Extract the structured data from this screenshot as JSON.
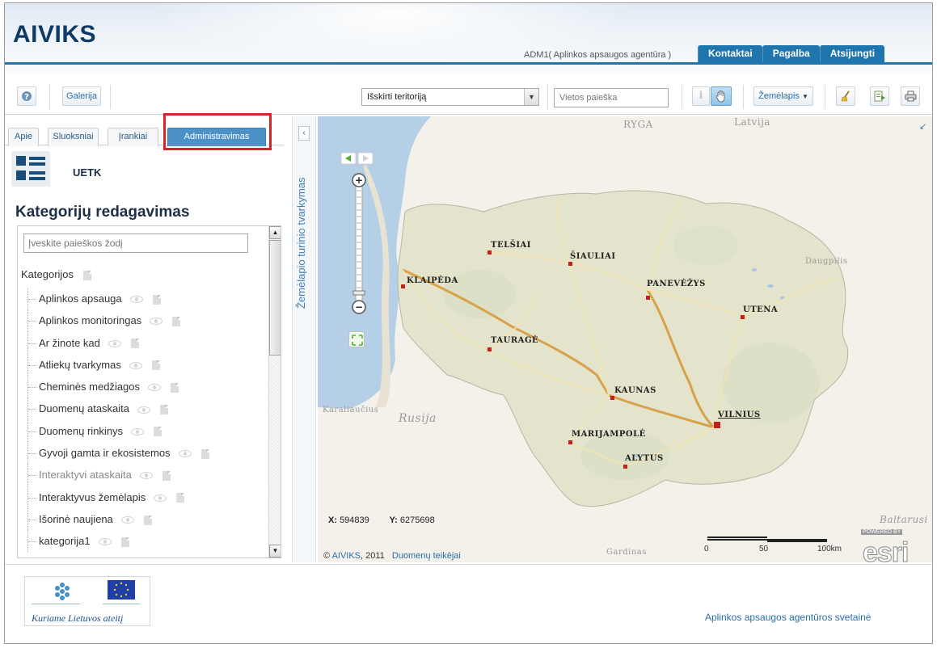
{
  "header": {
    "logo": "AIVIKS",
    "user": "ADM1( Aplinkos apsaugos agentūra )",
    "nav": [
      "Kontaktai",
      "Pagalba",
      "Atsijungti"
    ],
    "accent": "#1f75ae"
  },
  "toolbar": {
    "help_icon": "question-circle-icon",
    "gallery_label": "Galerija",
    "select_value": "Išskirti teritoriją",
    "search_placeholder": "Vietos paieška",
    "basemap_label": "Žemėlapis",
    "icons": [
      "info-icon",
      "pan-hand-icon",
      "clear-broom-icon",
      "export-icon",
      "print-icon"
    ]
  },
  "left_panel": {
    "tabs": [
      "Apie",
      "Sluoksniai",
      "Įrankiai",
      "Administravimas"
    ],
    "active_tab": "Administravimas",
    "module_label": "UETK",
    "title": "Kategorijų redagavimas",
    "search_placeholder": "Įveskite paieškos žodį",
    "root": "Kategorijos",
    "items": [
      {
        "label": "Aplinkos apsauga",
        "muted": false
      },
      {
        "label": "Aplinkos monitoringas",
        "muted": false
      },
      {
        "label": "Ar žinote kad",
        "muted": false
      },
      {
        "label": "Atliekų tvarkymas",
        "muted": false
      },
      {
        "label": "Cheminės medžiagos",
        "muted": false
      },
      {
        "label": "Duomenų ataskaita",
        "muted": false
      },
      {
        "label": "Duomenų rinkinys",
        "muted": false
      },
      {
        "label": "Gyvoji gamta ir ekosistemos",
        "muted": false
      },
      {
        "label": "Interaktyvi ataskaita",
        "muted": true
      },
      {
        "label": "Interaktyvus žemėlapis",
        "muted": false
      },
      {
        "label": "Išorinė naujiena",
        "muted": false
      },
      {
        "label": "kategorija1",
        "muted": false
      }
    ]
  },
  "side_title": "Žemėlapio turinio tvarkymas",
  "map": {
    "cities": [
      "TELŠIAI",
      "ŠIAULIAI",
      "KLAIPĖDA",
      "PANEVĖŽYS",
      "UTENA",
      "TAURAGĖ",
      "KAUNAS",
      "VILNIUS",
      "MARIJAMPOLĖ",
      "ALYTUS"
    ],
    "regions": [
      "RYGA",
      "Latvija",
      "Daugpilis",
      "Karaliaučius",
      "Rusija",
      "Baltarusi",
      "Gardinas"
    ],
    "x_label": "X:",
    "x_value": "594839",
    "y_label": "Y:",
    "y_value": "6275698",
    "attribution_prefix": "©",
    "attribution_org": "AIVIKS",
    "attribution_year": ", 2011",
    "attribution_link": "Duomenų teikėjai",
    "scale_labels": [
      "0",
      "50",
      "100km"
    ],
    "esri_label": "esri",
    "powered_by": "POWERED BY"
  },
  "footer": {
    "slogan": "Kuriame Lietuvos ateitį",
    "link": "Aplinkos apsaugos agentūros svetainė"
  }
}
